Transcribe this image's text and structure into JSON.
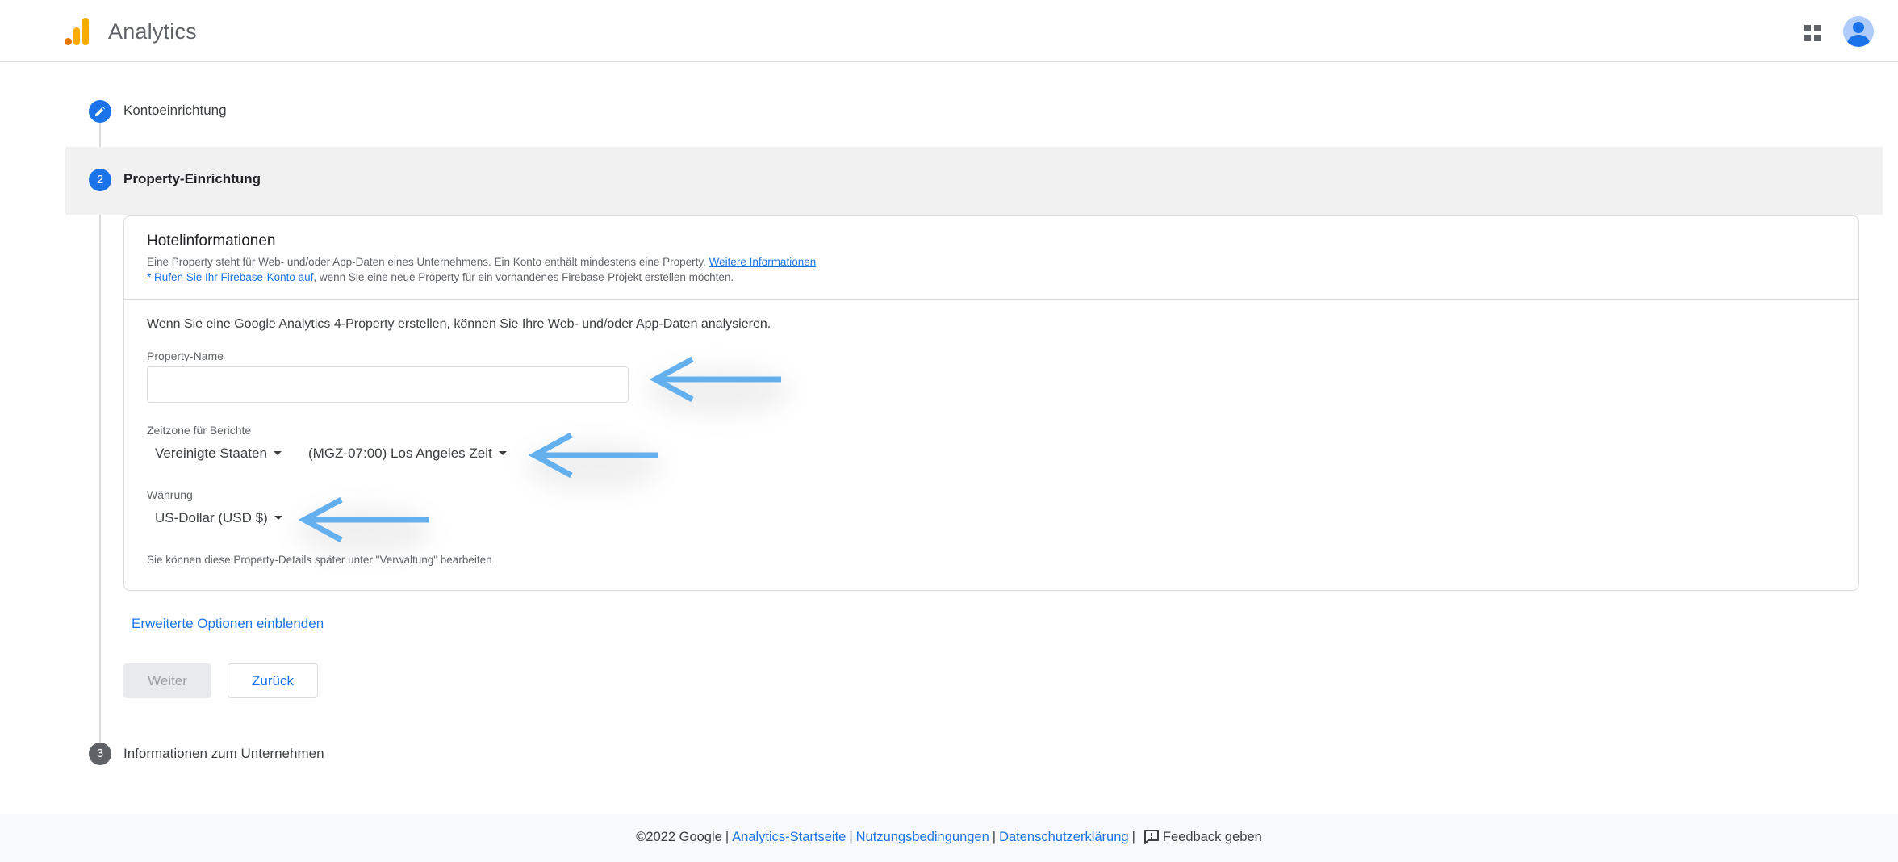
{
  "header": {
    "app_title": "Analytics",
    "icons": [
      "analytics-logo-icon",
      "apps-grid-icon",
      "account-avatar-icon"
    ]
  },
  "stepper": {
    "steps": [
      {
        "number": "1",
        "label": "Kontoeinrichtung",
        "state": "completed",
        "icon": "edit-pencil-icon"
      },
      {
        "number": "2",
        "label": "Property-Einrichtung",
        "state": "active"
      },
      {
        "number": "3",
        "label": "Informationen zum Unternehmen",
        "state": "upcoming"
      }
    ]
  },
  "card": {
    "title": "Hotelinformationen",
    "desc_line1": "Eine Property steht für Web- und/oder App-Daten eines Unternehmens. Ein Konto enthält mindestens eine Property. ",
    "desc_link1": "Weitere Informationen",
    "desc_link2": "* Rufen Sie Ihr Firebase-Konto auf",
    "desc_line2": ", wenn Sie eine neue Property für ein vorhandenes Firebase-Projekt erstellen möchten.",
    "intro": "Wenn Sie eine Google Analytics 4-Property erstellen, können Sie Ihre Web- und/oder App-Daten analysieren.",
    "property_name_label": "Property-Name",
    "property_name_value": "",
    "timezone_label": "Zeitzone für Berichte",
    "country_value": "Vereinigte Staaten",
    "timezone_value": "(MGZ-07:00) Los Angeles Zeit",
    "currency_label": "Währung",
    "currency_value": "US-Dollar (USD $)",
    "hint": "Sie können diese Property-Details später unter \"Verwaltung\" bearbeiten"
  },
  "actions": {
    "advanced_label": "Erweiterte Optionen einblenden",
    "next_label": "Weiter",
    "back_label": "Zurück"
  },
  "annotation_color": "#64b0ef",
  "footer": {
    "copyright": "©2022 Google",
    "link_home": "Analytics-Startseite",
    "link_terms": "Nutzungsbedingungen",
    "link_privacy": "Datenschutzerklärung",
    "feedback": "Feedback geben"
  }
}
